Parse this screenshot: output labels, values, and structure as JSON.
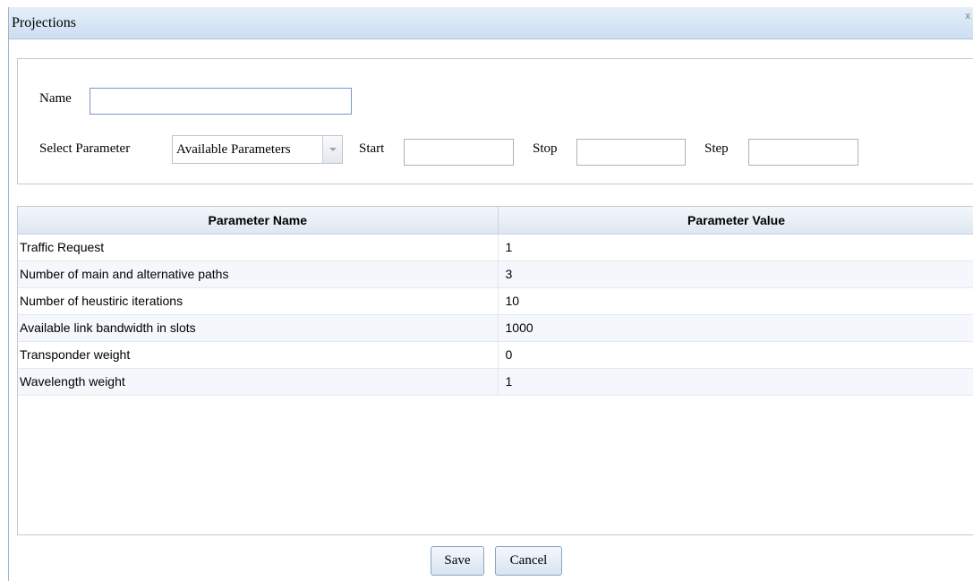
{
  "dialog": {
    "title": "Projections",
    "close_label": "x"
  },
  "form": {
    "name_label": "Name",
    "name_value": "",
    "select_param_label": "Select Parameter",
    "param_select_value": "Available Parameters",
    "start_label": "Start",
    "start_value": "",
    "stop_label": "Stop",
    "stop_value": "",
    "step_label": "Step",
    "step_value": ""
  },
  "table": {
    "columns": [
      "Parameter Name",
      "Parameter Value"
    ],
    "rows": [
      [
        "Traffic Request",
        "1"
      ],
      [
        "Number of main and alternative paths",
        "3"
      ],
      [
        "Number of heustiric iterations",
        "10"
      ],
      [
        "Available link bandwidth in slots",
        "1000"
      ],
      [
        "Transponder weight",
        "0"
      ],
      [
        "Wavelength weight",
        "1"
      ]
    ]
  },
  "buttons": {
    "save_label": "Save",
    "cancel_label": "Cancel"
  },
  "icons": {
    "dropdown": "chevron-down-icon",
    "close": "close-icon"
  }
}
